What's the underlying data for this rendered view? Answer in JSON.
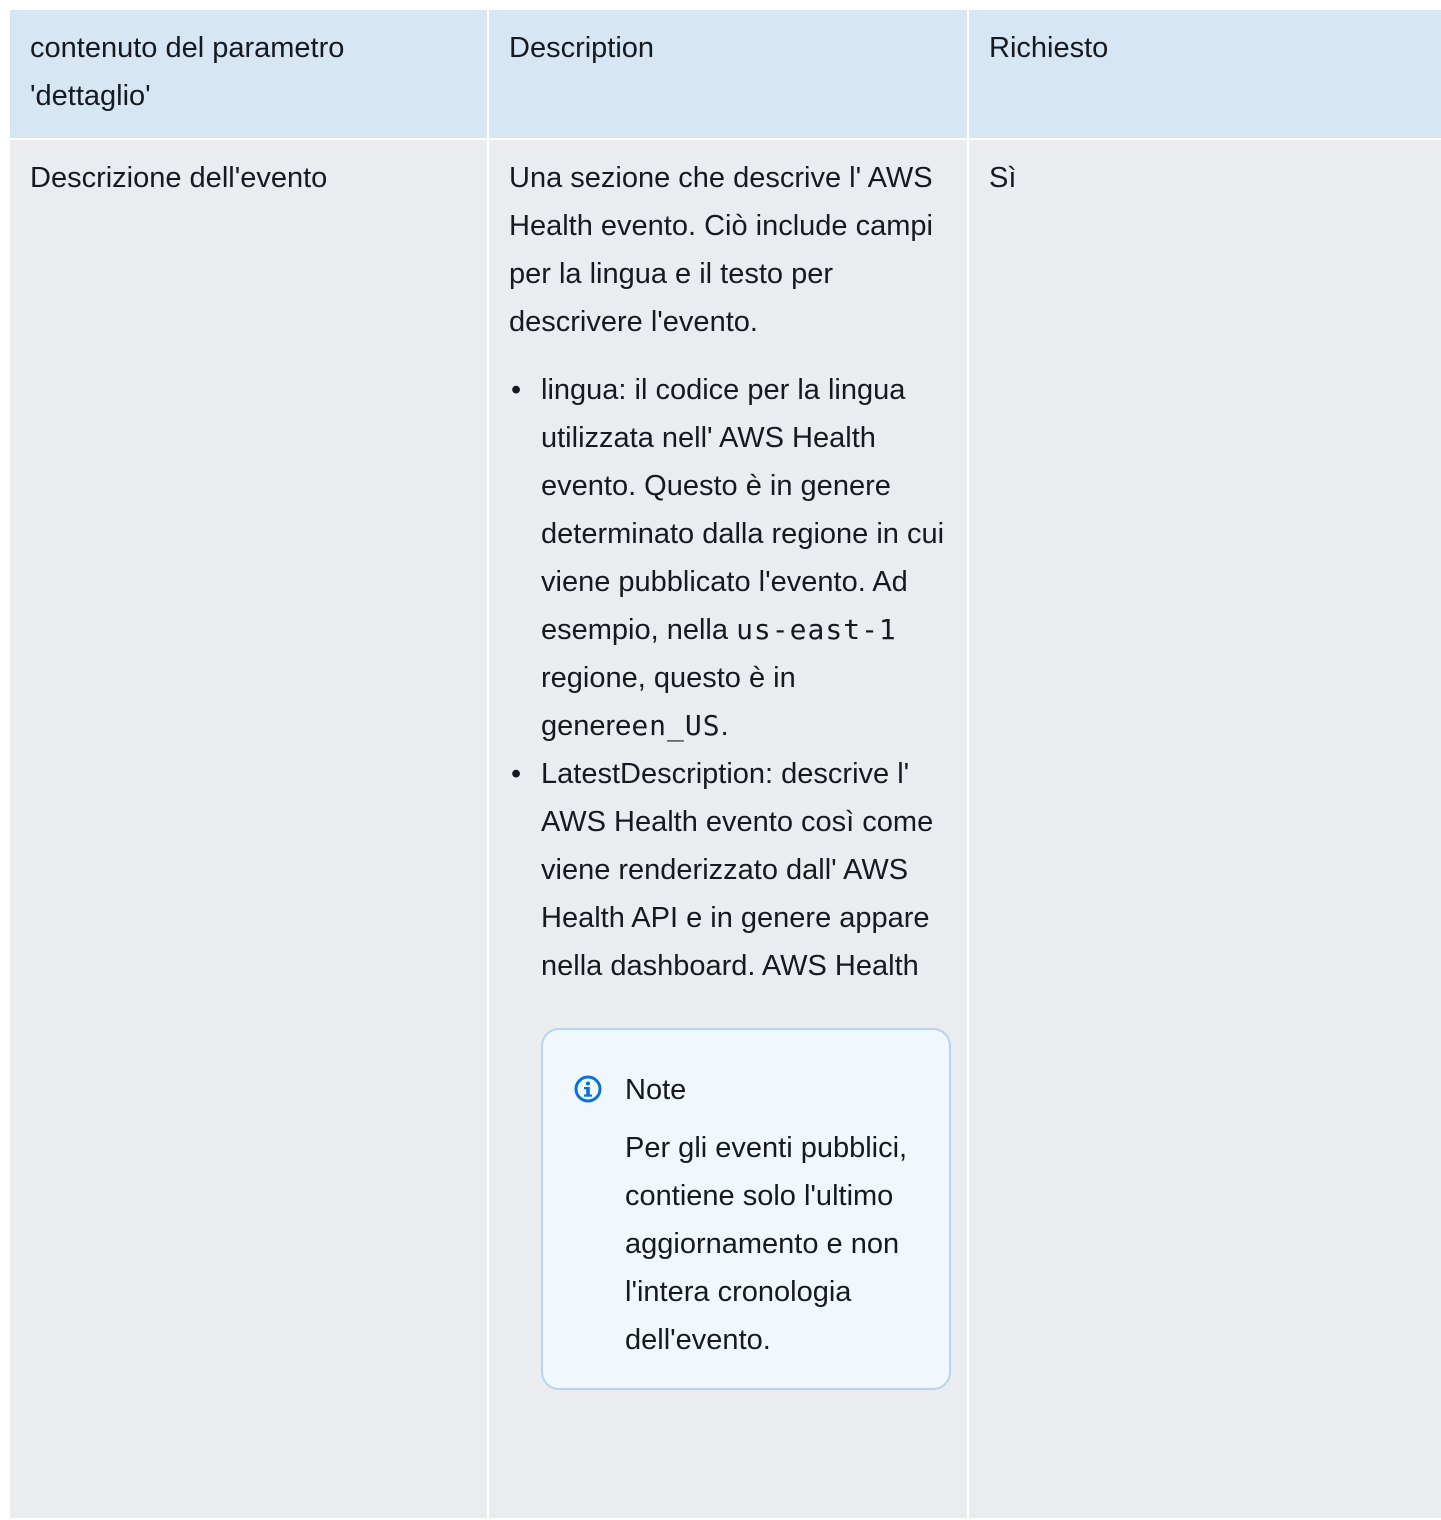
{
  "table": {
    "headers": [
      "contenuto del parametro 'dettaglio'",
      "Description",
      "Richiesto"
    ],
    "row": {
      "parameter": "Descrizione dell'evento",
      "description_intro": "Una sezione che descrive l' AWS Health evento. Ciò include campi per la lingua e il testo per descrivere l'evento.",
      "bullets": [
        {
          "text_before": "lingua: il codice per la lingua utilizzata nell' AWS Health evento. Questo è in genere determinato dalla regione in cui viene pubblicato l'evento. Ad esempio, nella ",
          "code1": "us-east-1",
          "text_middle": " regione, questo è in genere",
          "code2": "en_US",
          "text_after": "."
        },
        {
          "text": "LatestDescription: descrive l' AWS Health evento così come viene renderizzato dall' AWS Health API e in genere appare nella dashboard. AWS Health"
        }
      ],
      "note": {
        "icon": "info-icon",
        "title": "Note",
        "text": "Per gli eventi pubblici, contiene solo l'ultimo aggiornamento e non l'intera cronologia dell'evento."
      },
      "required": "Sì"
    },
    "colors": {
      "header_bg": "#d6e6f5",
      "row_bg": "#ebecef",
      "note_bg": "#f0f7fd",
      "note_border": "#b8d3ee",
      "info_icon": "#0972d3"
    }
  }
}
